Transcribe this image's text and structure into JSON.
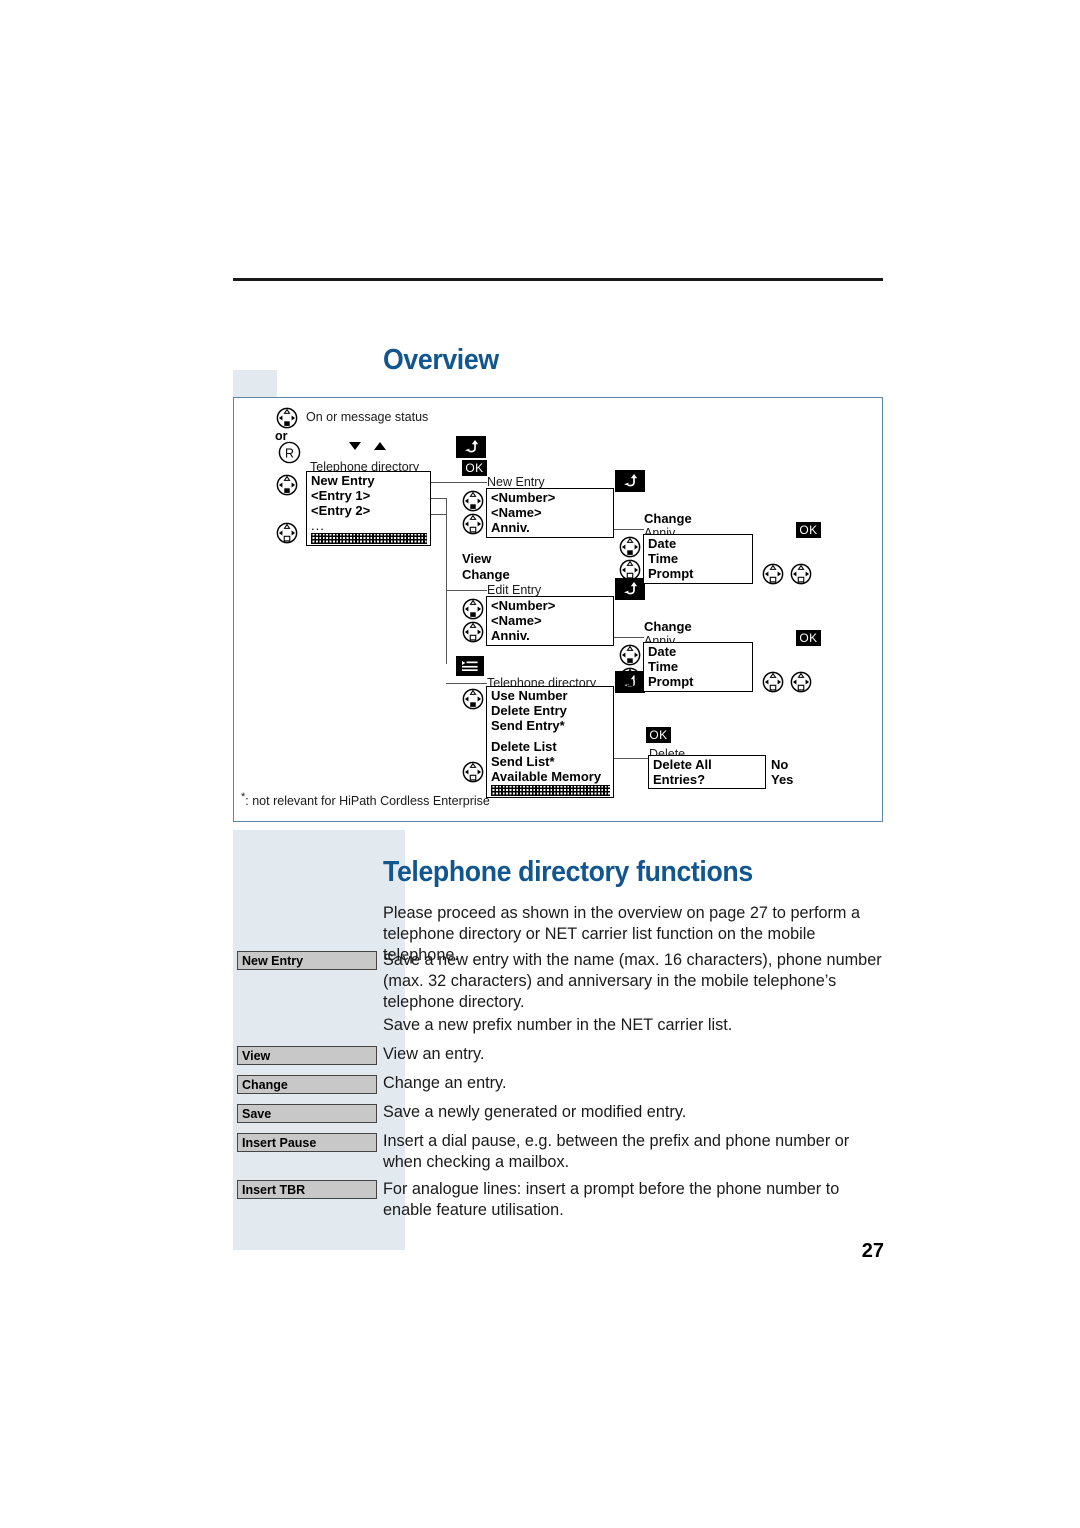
{
  "page": {
    "number": "27",
    "section_title": "Overview",
    "second_title": "Telephone directory functions"
  },
  "diagram": {
    "start": {
      "on_status_label": "On or message status",
      "or_label": "or",
      "r_key": "R",
      "list_header": "Telephone directory",
      "rows": [
        "New Entry",
        "<Entry 1>",
        "<Entry 2>",
        "..."
      ],
      "ok_key": "OK"
    },
    "new_entry": {
      "header": "New Entry",
      "rows": [
        "<Number>",
        "<Name>",
        "Anniv."
      ]
    },
    "view_change": {
      "view": "View",
      "change": "Change"
    },
    "edit_entry": {
      "header": "Edit Entry",
      "rows": [
        "<Number>",
        "<Name>",
        "Anniv."
      ]
    },
    "anniv_top": {
      "change_label": "Change",
      "header": "Anniv.",
      "rows": [
        "Date",
        "Time",
        "Prompt"
      ],
      "ok_key": "OK"
    },
    "anniv_bottom": {
      "change_label": "Change",
      "header": "Anniv.",
      "rows": [
        "Date",
        "Time",
        "Prompt"
      ],
      "ok_key": "OK"
    },
    "directory_menu": {
      "header": "Telephone directory",
      "rows_group1": [
        "Use Number",
        "Delete Entry",
        "Send Entry*"
      ],
      "rows_group2": [
        "Delete List",
        "Send List*",
        "Available Memory"
      ]
    },
    "delete": {
      "ok_key": "OK",
      "header": "Delete",
      "rows": [
        "Delete All",
        "Entries?"
      ],
      "options": [
        "No",
        "Yes"
      ]
    },
    "footnote": ": not relevant for HiPath Cordless Enterprise",
    "footnote_marker": "*"
  },
  "body": {
    "intro": "Please proceed as shown in the overview on page 27 to perform a telephone directory or NET carrier list function on the mobile telephone.",
    "entries": [
      {
        "key": "New Entry",
        "text": "Save a new entry with the name (max. 16 characters), phone number (max. 32 characters) and anniversary in the mobile telephone’s telephone directory."
      },
      {
        "key": "",
        "text": "Save a new prefix number in the NET carrier list."
      },
      {
        "key": "View",
        "text": "View an entry."
      },
      {
        "key": "Change",
        "text": "Change an entry."
      },
      {
        "key": "Save",
        "text": "Save a newly generated or modified entry."
      },
      {
        "key": "Insert Pause",
        "text": "Insert a dial pause, e.g. between the prefix and phone number or when checking a mailbox."
      },
      {
        "key": "Insert TBR",
        "text": "For analogue lines: insert a prompt before the phone number to enable feature utilisation."
      }
    ]
  },
  "colors": {
    "heading_blue": "#12568f",
    "strip_blue": "#e2eaf0",
    "key_grey": "#c8c8c8",
    "frame_blue": "#5b87ae"
  }
}
